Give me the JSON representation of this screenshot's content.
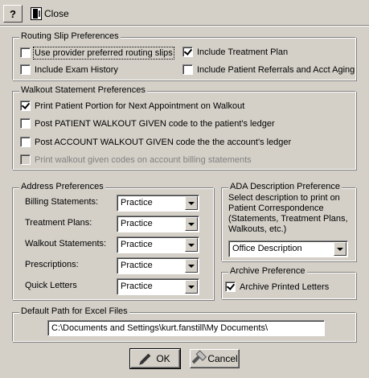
{
  "toolbar": {
    "help_label": "?",
    "close_label": "Close",
    "help_icon": "help-icon",
    "close_icon": "exit-door-icon"
  },
  "routing": {
    "title": "Routing Slip Preferences",
    "use_provider": {
      "label": "Use provider preferred routing slips",
      "checked": false
    },
    "include_exam": {
      "label": "Include Exam History",
      "checked": false
    },
    "include_treatment": {
      "label": "Include Treatment Plan",
      "checked": true
    },
    "include_referrals": {
      "label": "Include Patient Referrals and Acct Aging",
      "checked": false
    }
  },
  "walkout": {
    "title": "Walkout Statement Preferences",
    "print_portion": {
      "label": "Print Patient Portion for Next Appointment on Walkout",
      "checked": true
    },
    "post_patient": {
      "label": "Post PATIENT WALKOUT GIVEN code to the patient's ledger",
      "checked": false
    },
    "post_account": {
      "label": "Post ACCOUNT WALKOUT GIVEN code the the account's ledger",
      "checked": false
    },
    "print_codes": {
      "label": "Print walkout given codes on account billing statements",
      "checked": false,
      "disabled": true
    }
  },
  "address": {
    "title": "Address Preferences",
    "rows": [
      {
        "label": "Billing Statements:",
        "value": "Practice"
      },
      {
        "label": "Treatment Plans:",
        "value": "Practice"
      },
      {
        "label": "Walkout Statements:",
        "value": "Practice"
      },
      {
        "label": "Prescriptions:",
        "value": "Practice"
      },
      {
        "label": "Quick Letters",
        "value": "Practice"
      }
    ]
  },
  "ada": {
    "title": "ADA Description Preference",
    "description": "Select description to print on Patient Correspondence (Statements, Treatment Plans, Walkouts, etc.)",
    "value": "Office Description"
  },
  "archive": {
    "title": "Archive Preference",
    "archive_printed": {
      "label": "Archive Printed Letters",
      "checked": true
    }
  },
  "excel": {
    "title": "Default Path for Excel Files",
    "path": "C:\\Documents and Settings\\kurt.fanstill\\My Documents\\"
  },
  "buttons": {
    "ok_label": "OK",
    "cancel_label": "Cancel"
  },
  "colors": {
    "dialog_bg": "#d4d0c8",
    "field_bg": "#ffffff",
    "disabled_text": "#808080"
  }
}
